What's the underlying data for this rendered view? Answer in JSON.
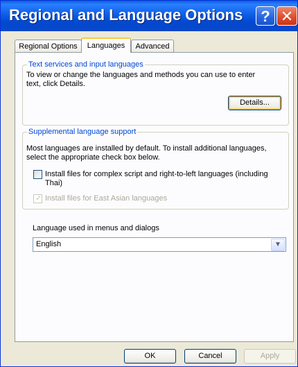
{
  "window": {
    "title": "Regional and Language Options",
    "help_glyph": "?",
    "close_glyph": "✕"
  },
  "tabs": [
    {
      "label": "Regional Options",
      "active": false
    },
    {
      "label": "Languages",
      "active": true
    },
    {
      "label": "Advanced",
      "active": false
    }
  ],
  "text_services": {
    "legend": "Text services and input languages",
    "line1": "To view or change the languages and methods you can use to enter",
    "line2": "text, click Details.",
    "details_label": "Details..."
  },
  "supplemental": {
    "legend": "Supplemental language support",
    "line1": "Most languages are installed by default. To install additional languages,",
    "line2": "select the appropriate check box below.",
    "complex_script_label_line1": "Install files for complex script and right-to-left languages (including",
    "complex_script_label_line2": "Thai)",
    "complex_script_checked": false,
    "east_asian_label": "Install files for East Asian languages",
    "east_asian_checked": true,
    "east_asian_enabled": false
  },
  "menu_language": {
    "label": "Language used in menus and dialogs",
    "selected": "English"
  },
  "footer": {
    "ok_label": "OK",
    "cancel_label": "Cancel",
    "apply_label": "Apply"
  }
}
